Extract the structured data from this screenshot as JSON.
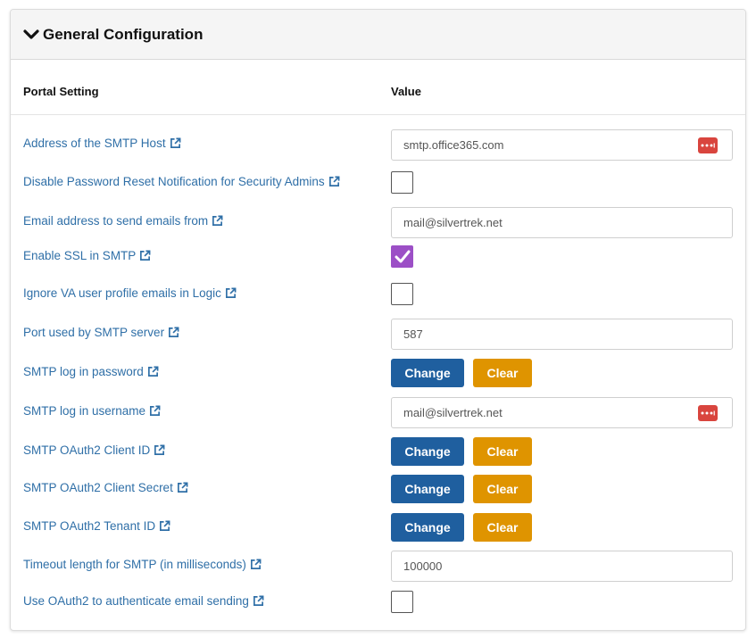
{
  "panel": {
    "title": "General Configuration"
  },
  "columns": {
    "setting": "Portal Setting",
    "value": "Value"
  },
  "rows": [
    {
      "label": "Address of the SMTP Host",
      "type": "text",
      "value": "smtp.office365.com",
      "password_manager_icon": true
    },
    {
      "label": "Disable Password Reset Notification for Security Admins",
      "type": "checkbox",
      "checked": false
    },
    {
      "label": "Email address to send emails from",
      "type": "text",
      "value": "mail@silvertrek.net"
    },
    {
      "label": "Enable SSL in SMTP",
      "type": "checkbox",
      "checked": true
    },
    {
      "label": "Ignore VA user profile emails in Logic",
      "type": "checkbox",
      "checked": false
    },
    {
      "label": "Port used by SMTP server",
      "type": "text",
      "value": "587"
    },
    {
      "label": "SMTP log in password",
      "type": "buttons",
      "change_label": "Change",
      "clear_label": "Clear"
    },
    {
      "label": "SMTP log in username",
      "type": "text",
      "value": "mail@silvertrek.net",
      "password_manager_icon": true
    },
    {
      "label": "SMTP OAuth2 Client ID",
      "type": "buttons",
      "change_label": "Change",
      "clear_label": "Clear"
    },
    {
      "label": "SMTP OAuth2 Client Secret",
      "type": "buttons",
      "change_label": "Change",
      "clear_label": "Clear"
    },
    {
      "label": "SMTP OAuth2 Tenant ID",
      "type": "buttons",
      "change_label": "Change",
      "clear_label": "Clear"
    },
    {
      "label": "Timeout length for SMTP (in milliseconds)",
      "type": "text",
      "value": "100000"
    },
    {
      "label": "Use OAuth2 to authenticate email sending",
      "type": "checkbox",
      "checked": false
    }
  ],
  "colors": {
    "link": "#2f6fa7",
    "change_button": "#1f5f9f",
    "clear_button": "#df9400",
    "checked_checkbox": "#9c4fc6",
    "password_manager_icon": "#d9453e"
  },
  "icons": {
    "collapse": "chevron-down-icon",
    "external_link": "external-link-icon",
    "password_manager": "password-manager-icon",
    "checkmark": "checkmark-icon"
  }
}
